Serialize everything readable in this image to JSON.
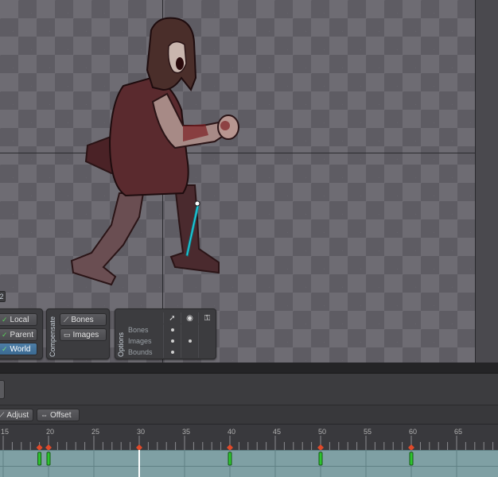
{
  "viewport": {
    "axes_label": "2"
  },
  "transform_panel": {
    "local_label": "Local",
    "parent_label": "Parent",
    "world_label": "World",
    "active": "World"
  },
  "compensate_panel": {
    "title": "Compensate",
    "bones_label": "Bones",
    "images_label": "Images"
  },
  "options_panel": {
    "title": "Options",
    "rows": [
      {
        "label": "Bones",
        "select": true,
        "visible": false,
        "key": false
      },
      {
        "label": "Images",
        "select": true,
        "visible": true,
        "key": false
      },
      {
        "label": "Bounds",
        "select": true,
        "visible": false,
        "key": false
      }
    ]
  },
  "timeline_tools": {
    "adjust_label": "Adjust",
    "offset_label": "Offset"
  },
  "ruler": {
    "labels": [
      "15",
      "20",
      "25",
      "30",
      "35",
      "40",
      "45",
      "50",
      "55",
      "60",
      "65"
    ]
  },
  "keyframes": {
    "frames": [
      19,
      20,
      30,
      40,
      50,
      60
    ],
    "current_frame": 30
  },
  "colors": {
    "accent": "#3b6a92",
    "keyframe_marker": "#e04a2a",
    "key_green": "#2ec42e",
    "bone": "#2ad1e0"
  }
}
